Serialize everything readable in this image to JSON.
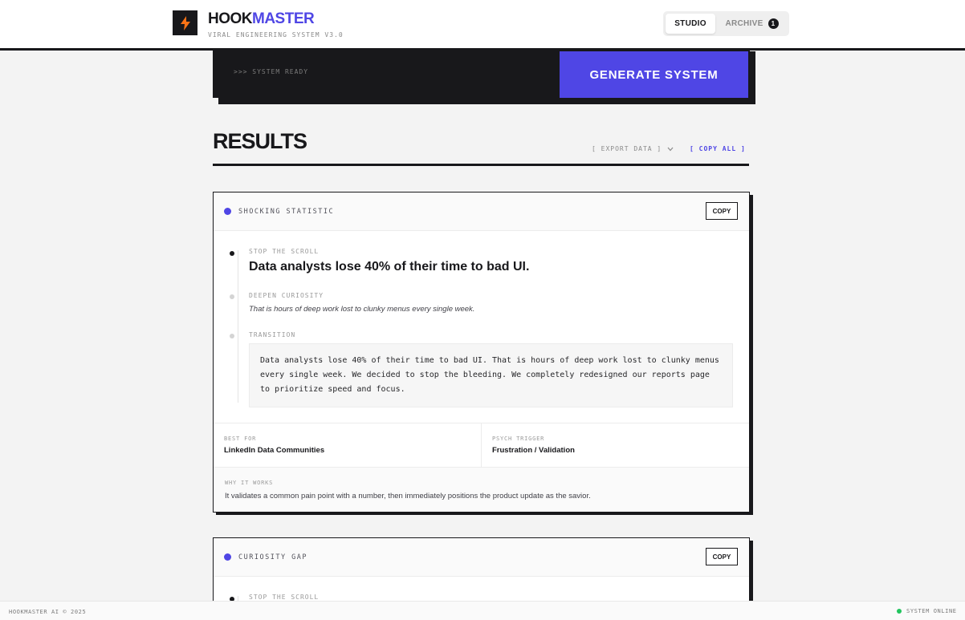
{
  "header": {
    "brand_part1": "HOOK",
    "brand_part2": "MASTER",
    "tagline": "VIRAL ENGINEERING SYSTEM V3.0",
    "tabs": [
      {
        "label": "STUDIO",
        "active": true
      },
      {
        "label": "ARCHIVE",
        "active": false,
        "badge": "1"
      }
    ]
  },
  "generator": {
    "status": ">>> SYSTEM READY",
    "button_label": "GENERATE SYSTEM"
  },
  "results": {
    "title": "RESULTS",
    "export_label": "[ EXPORT DATA ]",
    "copy_all_label": "[ COPY ALL ]",
    "cards": [
      {
        "title": "SHOCKING STATISTIC",
        "copy_label": "COPY",
        "steps": {
          "stop_label": "STOP THE SCROLL",
          "stop_text": "Data analysts lose 40% of their time to bad UI.",
          "deepen_label": "DEEPEN CURIOSITY",
          "deepen_text": "That is hours of deep work lost to clunky menus every single week.",
          "transition_label": "TRANSITION",
          "transition_text": "Data analysts lose 40% of their time to bad UI. That is hours of deep work lost to clunky menus every single week. We decided to stop the bleeding. We completely redesigned our reports page to prioritize speed and focus."
        },
        "best_for_label": "BEST FOR",
        "best_for": "LinkedIn Data Communities",
        "trigger_label": "PSYCH TRIGGER",
        "trigger": "Frustration / Validation",
        "why_label": "WHY IT WORKS",
        "why": "It validates a common pain point with a number, then immediately positions the product update as the savior."
      },
      {
        "title": "CURIOSITY GAP",
        "copy_label": "COPY",
        "steps": {
          "stop_label": "STOP THE SCROLL"
        }
      }
    ]
  },
  "footer": {
    "left": "HOOKMASTER AI © 2025",
    "right": "SYSTEM ONLINE"
  },
  "colors": {
    "accent": "#4f46e5",
    "ink": "#18181b",
    "online": "#22c55e"
  }
}
